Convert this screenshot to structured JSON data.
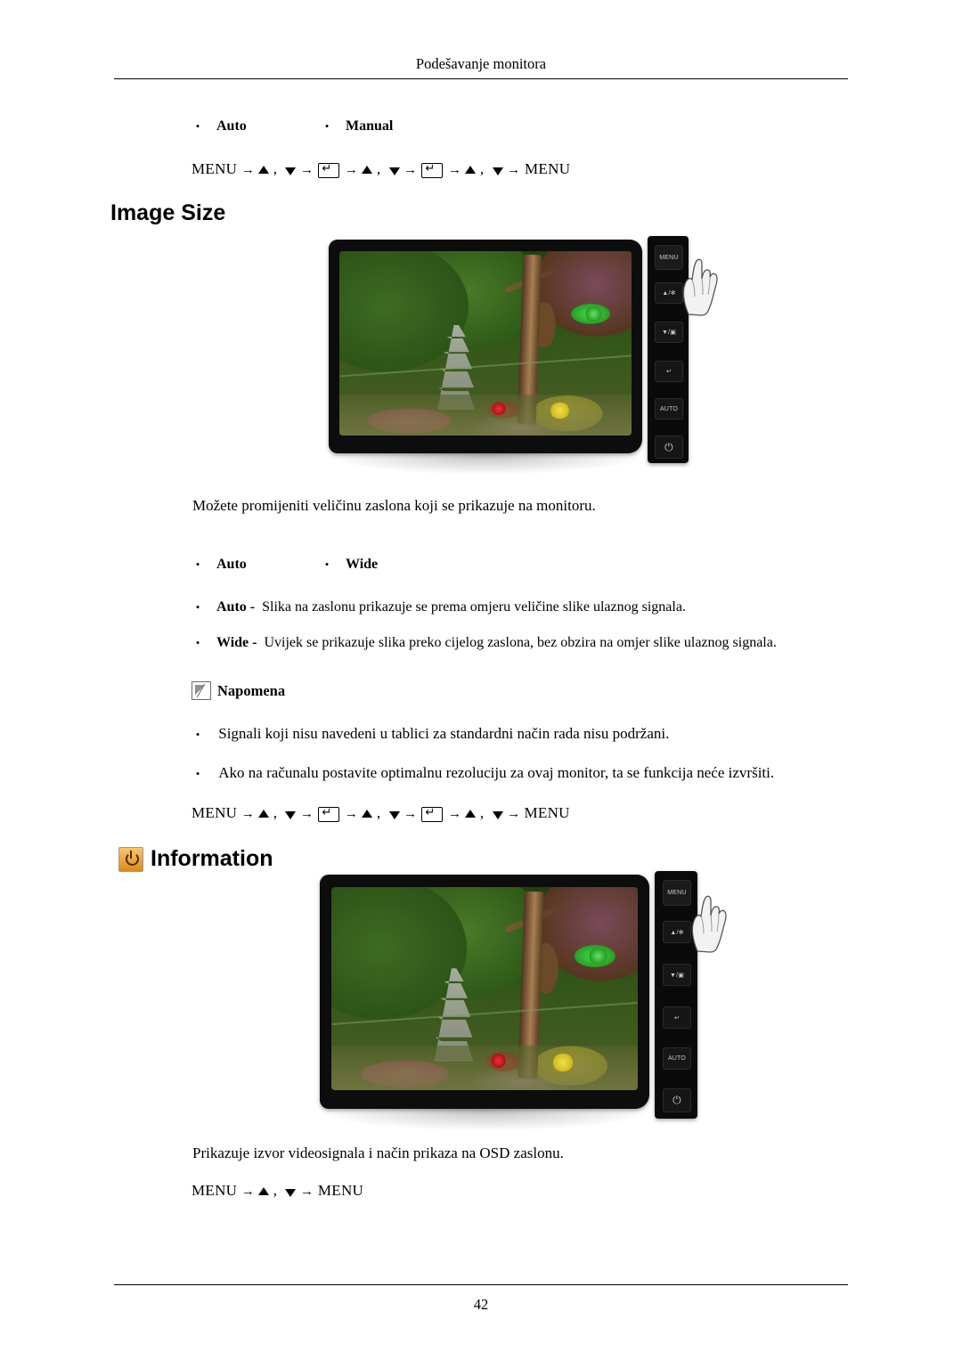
{
  "header": {
    "title": "Podešavanje monitora"
  },
  "footer": {
    "page_number": "42"
  },
  "top_block": {
    "option_auto": "Auto",
    "option_manual": "Manual",
    "menu_path_prefix": "MENU",
    "menu_path_suffix": "MENU"
  },
  "image_size": {
    "heading": "Image Size",
    "description": "Možete promijeniti veličinu zaslona koji se prikazuje na monitoru.",
    "option_auto": "Auto",
    "option_wide": "Wide",
    "bullet_auto_bold": "Auto -",
    "bullet_auto_text": "Slika na zaslonu prikazuje se prema omjeru veličine slike ulaznog signala.",
    "bullet_wide_bold": "Wide -",
    "bullet_wide_text": "Uvijek se prikazuje slika preko cijelog zaslona, bez obzira na omjer slike ulaznog signala.",
    "note_heading": "Napomena",
    "note_1": "Signali koji nisu navedeni u tablici za standardni način rada nisu podržani.",
    "note_2": "Ako na računalu postavite optimalnu rezoluciju za ovaj monitor, ta se funkcija neće izvršiti.",
    "menu_path_prefix": "MENU",
    "menu_path_suffix": "MENU"
  },
  "information": {
    "heading": "Information",
    "description": "Prikazuje izvor videosignala i način prikaza na OSD zaslonu.",
    "menu_path_prefix": "MENU",
    "menu_path_suffix": "MENU"
  },
  "monitor_buttons": {
    "menu": "MENU",
    "up": "▲/✻",
    "down": "▼/▣",
    "enter": "↵",
    "auto": "AUTO",
    "power": "⏻"
  }
}
